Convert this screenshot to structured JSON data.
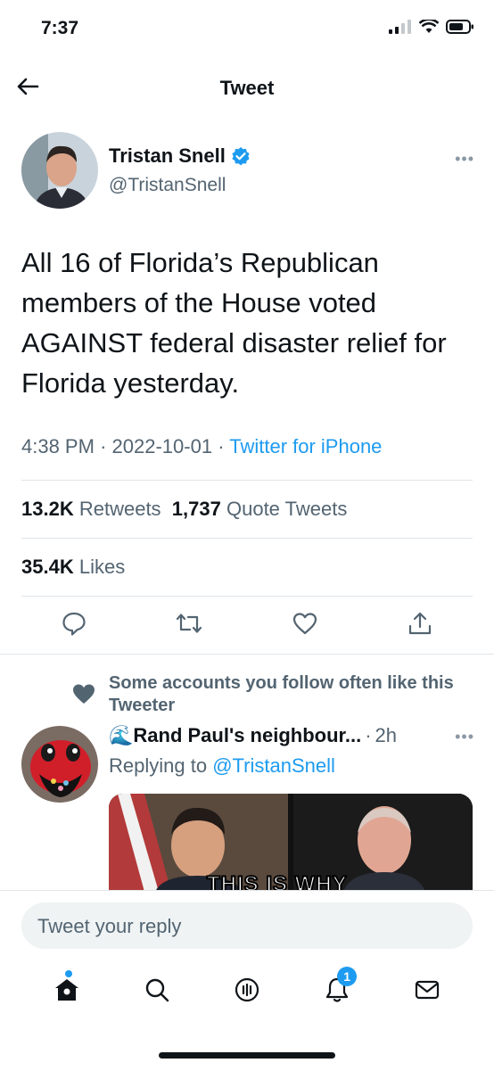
{
  "status_bar": {
    "time": "7:37"
  },
  "header": {
    "title": "Tweet"
  },
  "tweet": {
    "author_name": "Tristan Snell",
    "author_handle": "@TristanSnell",
    "text": "All 16 of Florida’s Republican members of the House voted AGAINST federal disaster relief for Florida yesterday.",
    "time": "4:38 PM",
    "date": "2022-10-01",
    "separator": "·",
    "source": "Twitter for iPhone",
    "retweets_count": "13.2K",
    "retweets_label": "Retweets",
    "quote_count": "1,737",
    "quote_label": "Quote Tweets",
    "likes_count": "35.4K",
    "likes_label": "Likes"
  },
  "social_context": {
    "text": "Some accounts you follow often like this Tweeter"
  },
  "reply": {
    "author_name": "🌊Rand Paul's neighbour...",
    "age": "2h",
    "separator": "·",
    "replying_prefix": "Replying to",
    "replying_handle": "@TristanSnell",
    "media_caption": "THIS IS WHY"
  },
  "composer": {
    "placeholder": "Tweet your reply"
  },
  "tabbar": {
    "notifications_badge": "1"
  },
  "colors": {
    "accent": "#1d9bf0",
    "text": "#0f1419",
    "secondary": "#536471"
  },
  "icons": [
    "back-arrow-icon",
    "verified-badge-icon",
    "more-icon",
    "reply-icon",
    "retweet-icon",
    "like-icon",
    "share-icon",
    "heart-icon",
    "home-icon",
    "search-icon",
    "spaces-icon",
    "notifications-icon",
    "messages-icon"
  ]
}
